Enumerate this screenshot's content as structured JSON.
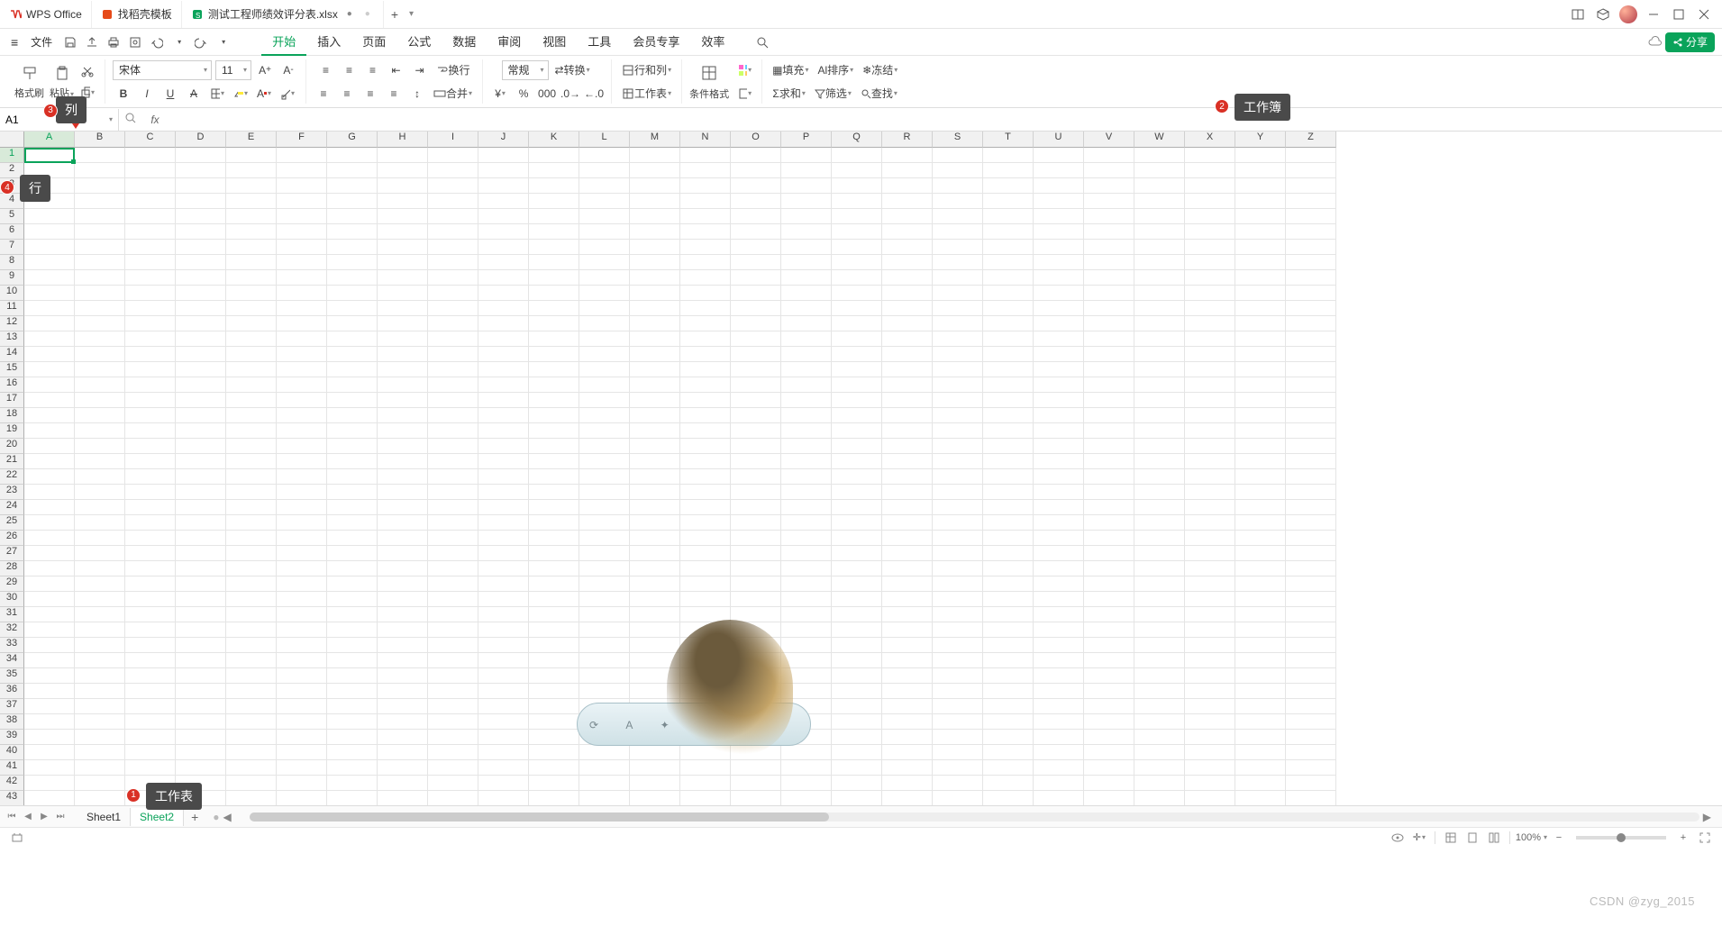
{
  "titlebar": {
    "app_name": "WPS Office",
    "tabs": [
      {
        "label": "找稻壳模板",
        "kind": "template"
      },
      {
        "label": "测试工程师绩效评分表.xlsx",
        "kind": "sheet",
        "active": true
      }
    ],
    "add_tab": "+",
    "add_drop": "▾"
  },
  "menubar": {
    "file": "文件",
    "tabs": [
      "开始",
      "插入",
      "页面",
      "公式",
      "数据",
      "审阅",
      "视图",
      "工具",
      "会员专享",
      "效率"
    ],
    "active_tab": "开始",
    "share": "分享"
  },
  "ribbon": {
    "clipboard": {
      "format_painter": "格式刷",
      "paste": "粘贴"
    },
    "font": {
      "name": "宋体",
      "size": "11"
    },
    "alignment": {
      "wrap": "换行",
      "merge": "合并"
    },
    "number": {
      "format": "常规",
      "convert": "转换"
    },
    "cells": {
      "rowcol": "行和列",
      "sheet": "工作表",
      "cond_format": "条件格式"
    },
    "editing": {
      "fill": "填充",
      "sort": "排序",
      "freeze": "冻结",
      "sum": "求和",
      "filter": "筛选",
      "find": "查找"
    }
  },
  "namebox": "A1",
  "grid": {
    "columns": [
      "A",
      "B",
      "C",
      "D",
      "E",
      "F",
      "G",
      "H",
      "I",
      "J",
      "K",
      "L",
      "M",
      "N",
      "O",
      "P",
      "Q",
      "R",
      "S",
      "T",
      "U",
      "V",
      "W",
      "X",
      "Y",
      "Z"
    ],
    "rows": 43,
    "selected_col": "A",
    "selected_row": 1
  },
  "sheets": {
    "tabs": [
      "Sheet1",
      "Sheet2"
    ],
    "active": "Sheet2",
    "add": "+"
  },
  "statusbar": {
    "zoom": "100%",
    "watermark": "CSDN @zyg_2015"
  },
  "annotations": {
    "worksheet": {
      "num": "1",
      "label": "工作表"
    },
    "workbook": {
      "num": "2",
      "label": "工作簿"
    },
    "column": {
      "num": "3",
      "label": "列"
    },
    "row": {
      "num": "4",
      "label": "行"
    }
  }
}
